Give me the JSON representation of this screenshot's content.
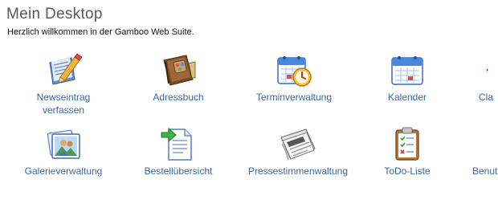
{
  "header": {
    "title": "Mein Desktop",
    "subtitle": "Herzlich willkommen in der Gamboo Web Suite."
  },
  "tiles": [
    {
      "label": "Newseintrag\nverfassen",
      "icon": "news-edit-icon"
    },
    {
      "label": "Adressbuch",
      "icon": "address-book-icon"
    },
    {
      "label": "Terminverwaltung",
      "icon": "appointment-calendar-icon"
    },
    {
      "label": "Kalender",
      "icon": "calendar-icon"
    },
    {
      "label": "Cla",
      "icon": "truncated-icon"
    },
    {
      "label": "Galerieverwaltung",
      "icon": "gallery-icon"
    },
    {
      "label": "Bestellübersicht",
      "icon": "order-document-icon"
    },
    {
      "label": "Pressestimmenwaltung",
      "icon": "newspaper-icon"
    },
    {
      "label": "ToDo-Liste",
      "icon": "clipboard-todo-icon"
    },
    {
      "label": "Benut",
      "icon": "truncated-icon"
    }
  ]
}
